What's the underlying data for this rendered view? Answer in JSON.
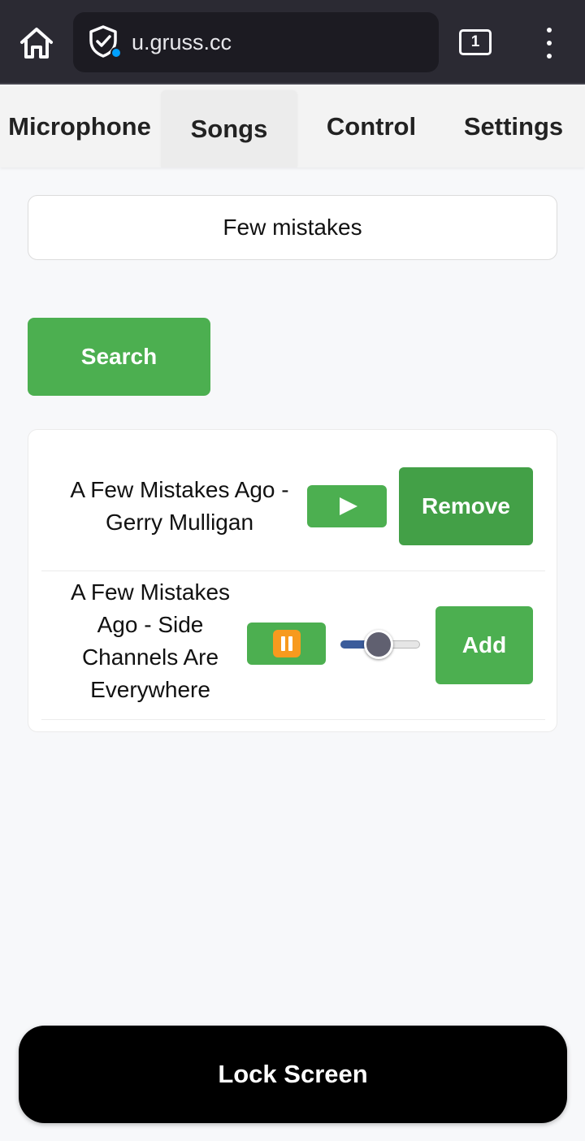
{
  "browser": {
    "url": "u.gruss.cc",
    "tab_count": "1",
    "icons": {
      "home": "home-icon",
      "security": "shield-check-icon",
      "tabs": "tabs-icon",
      "menu": "more-vertical-icon"
    }
  },
  "tabs": [
    {
      "label": "Microphone",
      "active": false
    },
    {
      "label": "Songs",
      "active": true
    },
    {
      "label": "Control",
      "active": false
    },
    {
      "label": "Settings",
      "active": false
    }
  ],
  "search": {
    "value": "Few mistakes",
    "button_label": "Search"
  },
  "results": [
    {
      "title": "A Few Mistakes Ago - Gerry Mulligan",
      "state": "stopped",
      "play_icon": "play-icon",
      "action_label": "Remove"
    },
    {
      "title": "A Few Mistakes Ago - Side Channels Are Everywhere",
      "state": "playing",
      "play_icon": "pause-icon",
      "progress": 0.46,
      "action_label": "Add"
    }
  ],
  "lock_button_label": "Lock Screen",
  "colors": {
    "accent_green": "#4caf50",
    "remove_green": "#43a047",
    "pause_orange": "#f79a1e",
    "slider_fill": "#3b5c9b",
    "browser_bar": "#2b2a33"
  }
}
